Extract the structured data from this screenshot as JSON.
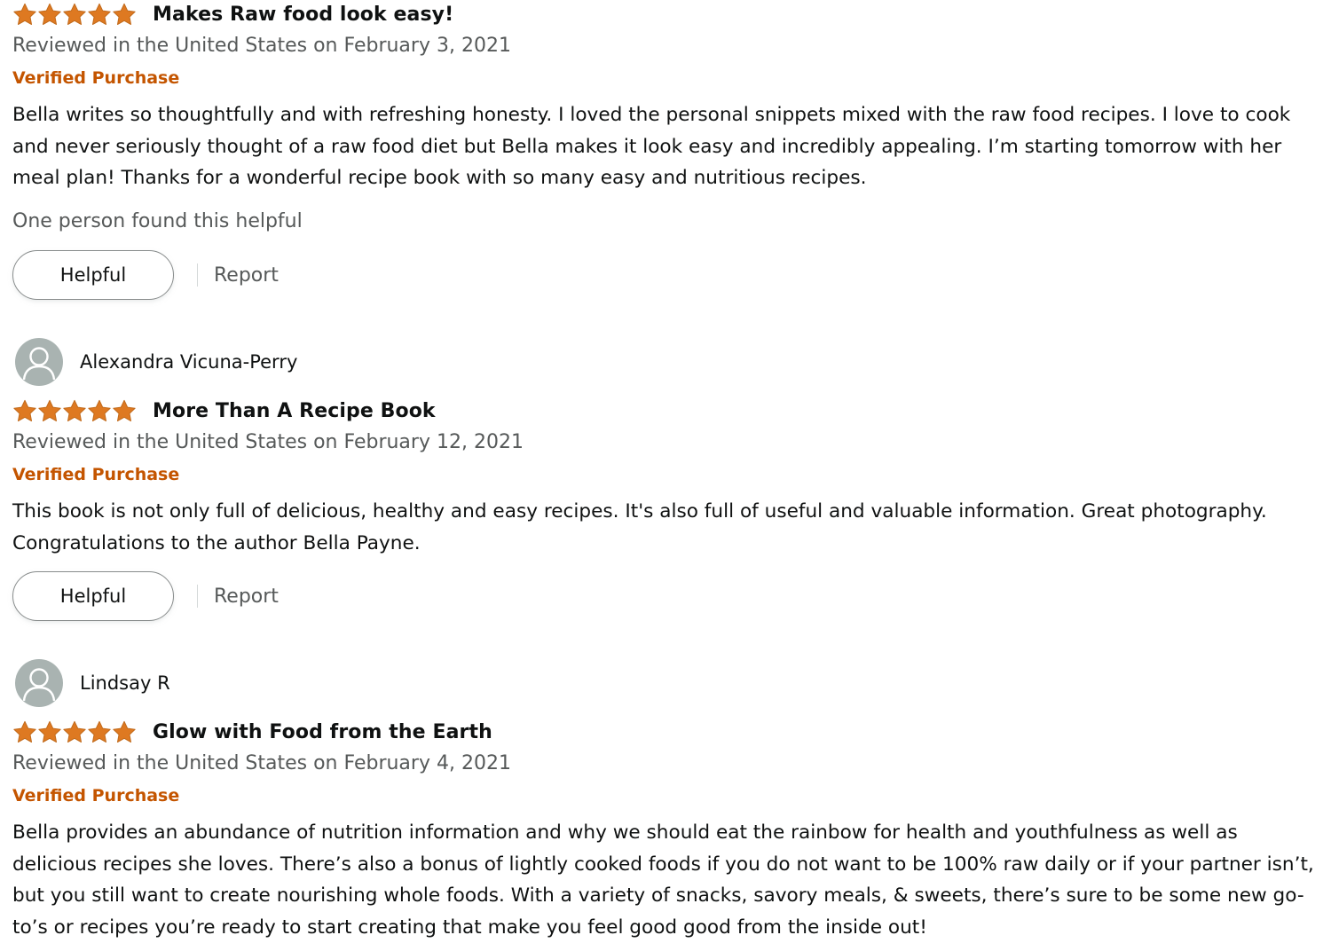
{
  "reviews": [
    {
      "reviewer": "",
      "rating": 5,
      "title": "Makes Raw food look easy!",
      "date": "Reviewed in the United States on February 3, 2021",
      "verified": "Verified Purchase",
      "body": "Bella writes so thoughtfully and with refreshing honesty. I loved the personal snippets mixed with the raw food recipes. I love to cook and never seriously thought of a raw food diet but Bella makes it look easy and incredibly appealing. I’m starting tomorrow with her meal plan! Thanks for a wonderful recipe book with so many easy and nutritious recipes.",
      "helpful_count": "One person found this helpful",
      "helpful_label": "Helpful",
      "report_label": "Report"
    },
    {
      "reviewer": "Alexandra Vicuna-Perry",
      "rating": 5,
      "title": "More Than A Recipe Book",
      "date": "Reviewed in the United States on February 12, 2021",
      "verified": "Verified Purchase",
      "body": "This book is not only full of delicious, healthy and easy recipes. It's also full of useful and valuable information. Great photography. Congratulations to the author Bella Payne.",
      "helpful_label": "Helpful",
      "report_label": "Report"
    },
    {
      "reviewer": "Lindsay R",
      "rating": 5,
      "title": "Glow with Food from the Earth",
      "date": "Reviewed in the United States on February 4, 2021",
      "verified": "Verified Purchase",
      "body": "Bella provides an abundance of nutrition information and why we should eat the rainbow for health and youthfulness as well as delicious recipes she loves. There’s also a bonus of lightly cooked foods if you do not want to be 100% raw daily or if your partner isn’t, but you still want to create nourishing whole foods. With a variety of snacks, savory meals, & sweets, there’s sure to be some new go-to’s or recipes you’re ready to start creating that make you feel good good from the inside out!"
    }
  ],
  "colors": {
    "star": "#de7921",
    "verified": "#c45500",
    "muted_text": "#565959",
    "avatar": "#a9b3b1"
  },
  "icons": {
    "star": "star-icon",
    "avatar": "user-silhouette-icon"
  }
}
